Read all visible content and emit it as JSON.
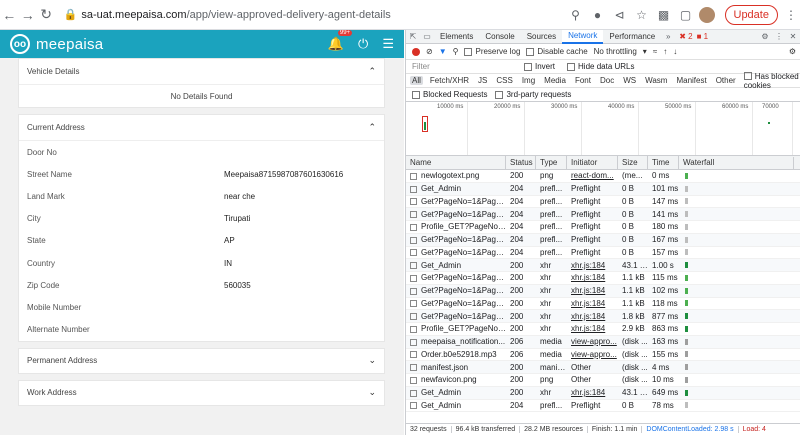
{
  "browser": {
    "url_host": "sa-uat.meepaisa.com",
    "url_path": "/app/view-approved-delivery-agent-details",
    "update_label": "Update"
  },
  "app": {
    "logo_text": "meepaisa",
    "badge": "99+",
    "vehicle": {
      "title": "Vehicle Details",
      "empty": "No Details Found"
    },
    "address": {
      "title": "Current Address",
      "rows": [
        {
          "label": "Door No",
          "value": ""
        },
        {
          "label": "Street Name",
          "value": "Meepaisa8715987087601630616"
        },
        {
          "label": "Land Mark",
          "value": "near che"
        },
        {
          "label": "City",
          "value": "Tirupati"
        },
        {
          "label": "State",
          "value": "AP"
        },
        {
          "label": "Country",
          "value": "IN"
        },
        {
          "label": "Zip Code",
          "value": "560035"
        },
        {
          "label": "Mobile Number",
          "value": ""
        },
        {
          "label": "Alternate Number",
          "value": ""
        }
      ]
    },
    "permanent_title": "Permanent Address",
    "work_title": "Work Address"
  },
  "devtools": {
    "tabs": [
      "Elements",
      "Console",
      "Sources",
      "Network",
      "Performance"
    ],
    "active_tab": "Network",
    "errors": "2",
    "messages": "1",
    "toolbar": {
      "preserve_log": "Preserve log",
      "disable_cache": "Disable cache",
      "throttle": "No throttling"
    },
    "filter_placeholder": "Filter",
    "invert": "Invert",
    "hide_data": "Hide data URLs",
    "types": [
      "All",
      "Fetch/XHR",
      "JS",
      "CSS",
      "Img",
      "Media",
      "Font",
      "Doc",
      "WS",
      "Wasm",
      "Manifest",
      "Other"
    ],
    "has_blocked": "Has blocked cookies",
    "blocked_requests": "Blocked Requests",
    "third_party": "3rd-party requests",
    "timeline_ticks": [
      "10000 ms",
      "20000 ms",
      "30000 ms",
      "40000 ms",
      "50000 ms",
      "60000 ms",
      "70000"
    ],
    "columns": [
      "Name",
      "Status",
      "Type",
      "Initiator",
      "Size",
      "Time",
      "Waterfall"
    ],
    "rows": [
      {
        "name": "newlogotext.png",
        "status": "200",
        "type": "png",
        "initiator": "react-dom...",
        "size": "(me...",
        "time": "0 ms",
        "link": true,
        "wf_color": "#4caf50"
      },
      {
        "name": "Get_Admin",
        "status": "204",
        "type": "prefl...",
        "initiator": "Preflight",
        "size": "0 B",
        "time": "101 ms",
        "link": false,
        "wf_color": "#bdbdbd"
      },
      {
        "name": "Get?PageNo=1&PageS...",
        "status": "204",
        "type": "prefl...",
        "initiator": "Preflight",
        "size": "0 B",
        "time": "147 ms",
        "link": false,
        "wf_color": "#bdbdbd"
      },
      {
        "name": "Get?PageNo=1&PageS...",
        "status": "204",
        "type": "prefl...",
        "initiator": "Preflight",
        "size": "0 B",
        "time": "141 ms",
        "link": false,
        "wf_color": "#bdbdbd"
      },
      {
        "name": "Profile_GET?PageNo=...",
        "status": "204",
        "type": "prefl...",
        "initiator": "Preflight",
        "size": "0 B",
        "time": "180 ms",
        "link": false,
        "wf_color": "#bdbdbd"
      },
      {
        "name": "Get?PageNo=1&PageS...",
        "status": "204",
        "type": "prefl...",
        "initiator": "Preflight",
        "size": "0 B",
        "time": "167 ms",
        "link": false,
        "wf_color": "#bdbdbd"
      },
      {
        "name": "Get?PageNo=1&PageS...",
        "status": "204",
        "type": "prefl...",
        "initiator": "Preflight",
        "size": "0 B",
        "time": "157 ms",
        "link": false,
        "wf_color": "#bdbdbd"
      },
      {
        "name": "Get_Admin",
        "status": "200",
        "type": "xhr",
        "initiator": "xhr.js:184",
        "size": "43.1 kB",
        "time": "1.00 s",
        "link": true,
        "wf_color": "#1e8e3e"
      },
      {
        "name": "Get?PageNo=1&PageS...",
        "status": "200",
        "type": "xhr",
        "initiator": "xhr.js:184",
        "size": "1.1 kB",
        "time": "115 ms",
        "link": true,
        "wf_color": "#4caf50"
      },
      {
        "name": "Get?PageNo=1&PageS...",
        "status": "200",
        "type": "xhr",
        "initiator": "xhr.js:184",
        "size": "1.1 kB",
        "time": "102 ms",
        "link": true,
        "wf_color": "#4caf50"
      },
      {
        "name": "Get?PageNo=1&PageS...",
        "status": "200",
        "type": "xhr",
        "initiator": "xhr.js:184",
        "size": "1.1 kB",
        "time": "118 ms",
        "link": true,
        "wf_color": "#4caf50"
      },
      {
        "name": "Get?PageNo=1&PageS...",
        "status": "200",
        "type": "xhr",
        "initiator": "xhr.js:184",
        "size": "1.8 kB",
        "time": "877 ms",
        "link": true,
        "wf_color": "#1e8e3e"
      },
      {
        "name": "Profile_GET?PageNo=...",
        "status": "200",
        "type": "xhr",
        "initiator": "xhr.js:184",
        "size": "2.9 kB",
        "time": "863 ms",
        "link": true,
        "wf_color": "#1e8e3e"
      },
      {
        "name": "meepaisa_notification...",
        "status": "206",
        "type": "media",
        "initiator": "view-appro...",
        "size": "(disk ...",
        "time": "163 ms",
        "link": true,
        "wf_color": "#9e9e9e"
      },
      {
        "name": "Order.b0e52918.mp3",
        "status": "206",
        "type": "media",
        "initiator": "view-appro...",
        "size": "(disk ...",
        "time": "155 ms",
        "link": true,
        "wf_color": "#9e9e9e"
      },
      {
        "name": "manifest.json",
        "status": "200",
        "type": "manifest",
        "initiator": "Other",
        "size": "(disk ...",
        "time": "4 ms",
        "link": false,
        "wf_color": "#9e9e9e"
      },
      {
        "name": "newfavicon.png",
        "status": "200",
        "type": "png",
        "initiator": "Other",
        "size": "(disk ...",
        "time": "10 ms",
        "link": false,
        "wf_color": "#9e9e9e"
      },
      {
        "name": "Get_Admin",
        "status": "200",
        "type": "xhr",
        "initiator": "xhr.js:184",
        "size": "43.1 kB",
        "time": "649 ms",
        "link": true,
        "wf_color": "#1e8e3e"
      },
      {
        "name": "Get_Admin",
        "status": "204",
        "type": "prefl...",
        "initiator": "Preflight",
        "size": "0 B",
        "time": "78 ms",
        "link": false,
        "wf_color": "#bdbdbd"
      }
    ],
    "status_bar": {
      "requests": "32 requests",
      "transferred": "96.4 kB transferred",
      "resources": "28.2 MB resources",
      "finish": "Finish: 1.1 min",
      "dcl": "DOMContentLoaded: 2.98 s",
      "load": "Load: 4"
    }
  }
}
